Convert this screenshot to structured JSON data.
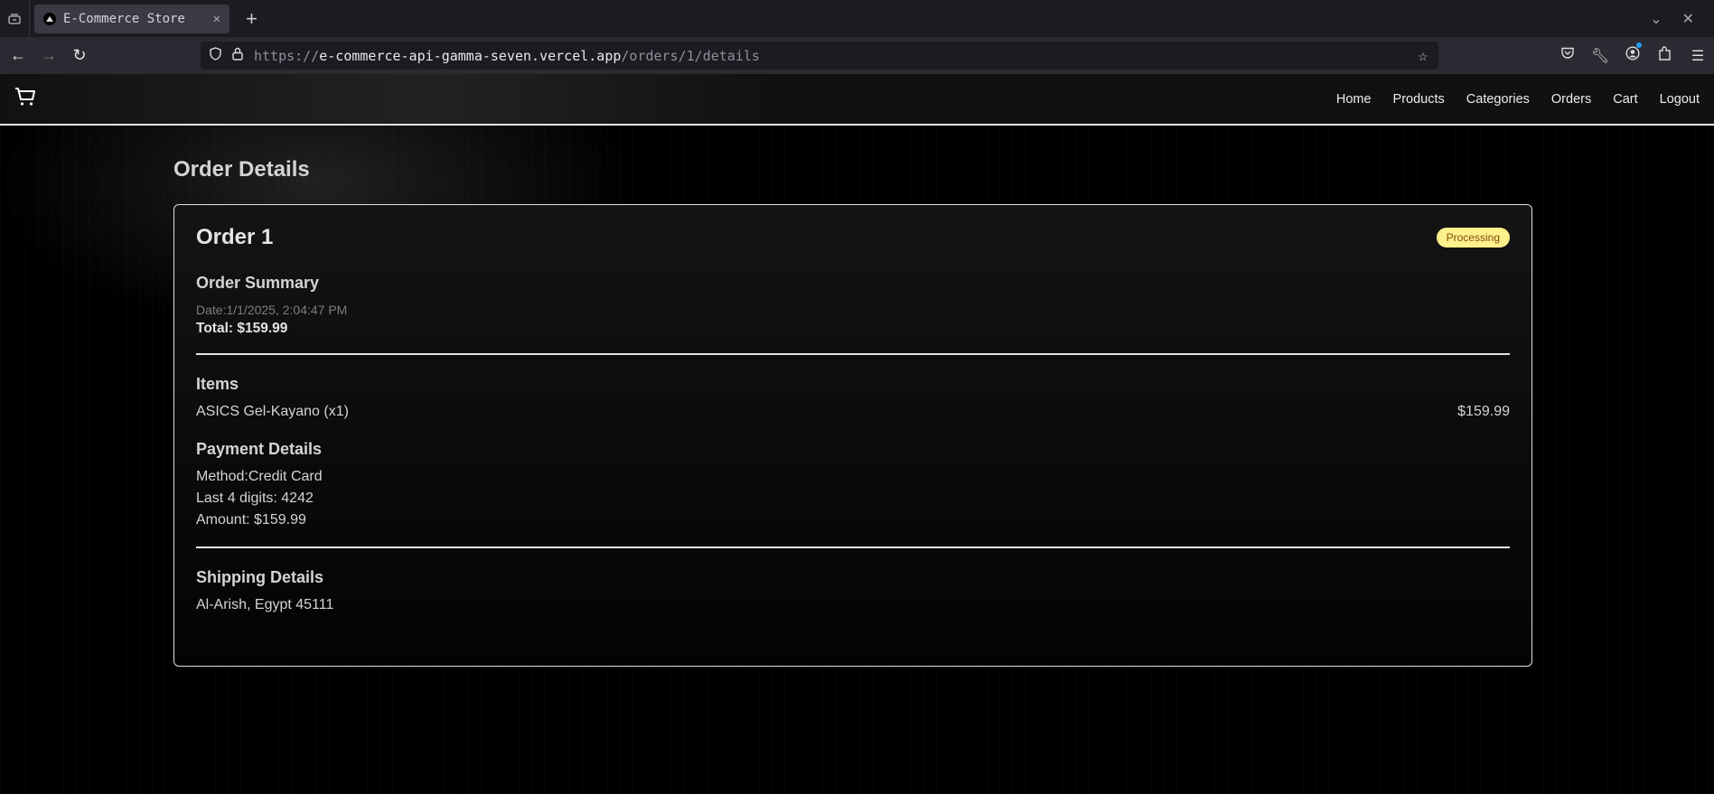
{
  "browser": {
    "tab_title": "E-Commerce Store",
    "url_scheme": "https://",
    "url_host": "e-commerce-api-gamma-seven.vercel.app",
    "url_path": "/orders/1/details"
  },
  "nav": {
    "items": [
      "Home",
      "Products",
      "Categories",
      "Orders",
      "Cart",
      "Logout"
    ]
  },
  "page": {
    "title": "Order Details",
    "order_title": "Order 1",
    "status": "Processing",
    "status_colors": {
      "bg": "#fef08a",
      "fg": "#854d0e"
    },
    "summary": {
      "heading": "Order Summary",
      "date": "Date:1/1/2025, 2:04:47 PM",
      "total": "Total: $159.99"
    },
    "items": {
      "heading": "Items",
      "list": [
        {
          "name": "ASICS Gel-Kayano (x1)",
          "price": "$159.99"
        }
      ]
    },
    "payment": {
      "heading": "Payment Details",
      "method": "Method:Credit Card",
      "last4": "Last 4 digits: 4242",
      "amount": "Amount: $159.99"
    },
    "shipping": {
      "heading": "Shipping Details",
      "address": "Al-Arish, Egypt 45111"
    }
  }
}
